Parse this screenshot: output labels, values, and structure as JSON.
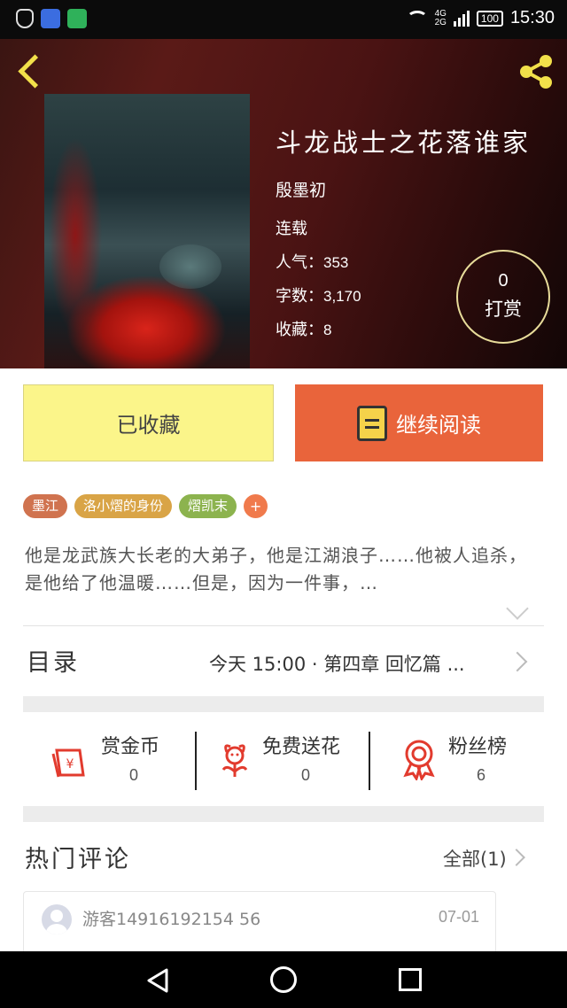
{
  "status_bar": {
    "time": "15:30",
    "battery": "100",
    "network": "4G",
    "network2": "2G"
  },
  "book": {
    "title": "斗龙战士之花落谁家",
    "author": "殷墨初",
    "status": "连载",
    "popularity_label": "人气：",
    "popularity": "353",
    "words_label": "字数：",
    "words": "3,170",
    "favorites_label": "收藏：",
    "favorites": "8",
    "reward_count": "0",
    "reward_label": "打赏"
  },
  "actions": {
    "collected_label": "已收藏",
    "read_label": "继续阅读"
  },
  "tags": [
    {
      "label": "墨江",
      "color": "#d0734f"
    },
    {
      "label": "洛小熠的身份",
      "color": "#d9a446"
    },
    {
      "label": "熠凯末",
      "color": "#8cb34e"
    }
  ],
  "tag_add": "+",
  "description": "他是龙武族大长老的大弟子，他是江湖浪子……他被人追杀，是他给了他温暖……但是，因为一件事，…",
  "toc": {
    "label": "目录",
    "latest": "今天 15:00 · 第四章 回忆篇 ..."
  },
  "stats": [
    {
      "label": "赏金币",
      "value": "0",
      "icon": "money-envelope-icon"
    },
    {
      "label": "免费送花",
      "value": "0",
      "icon": "flower-icon"
    },
    {
      "label": "粉丝榜",
      "value": "6",
      "icon": "medal-icon"
    }
  ],
  "comments": {
    "title": "热门评论",
    "all_label": "全部(1)",
    "items": [
      {
        "user": "游客14916192154 56",
        "date": "07-01"
      }
    ]
  },
  "colors": {
    "accent_orange": "#e9643b",
    "collected_yellow": "#fbf58a",
    "icon_red": "#e23b2e",
    "back_yellow": "#f2e04a"
  }
}
